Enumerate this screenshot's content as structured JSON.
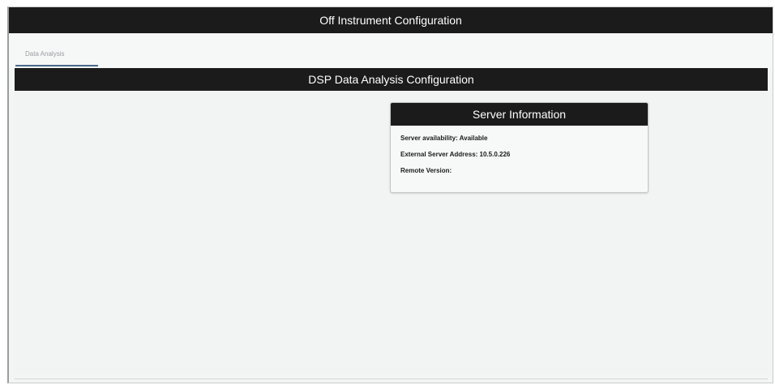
{
  "header": {
    "title": "Off Instrument Configuration"
  },
  "tabs": [
    {
      "label": "Data Analysis",
      "active": true
    }
  ],
  "section": {
    "title": "DSP Data Analysis Configuration"
  },
  "server_info": {
    "title": "Server Information",
    "rows": [
      "Server availability: Available",
      "External Server Address: 10.5.0.226",
      "Remote Version:"
    ]
  },
  "colors": {
    "header_bg": "#1b1b1b",
    "page_bg": "#f3f4f4",
    "tab_indicator": "#4a6a8a"
  }
}
